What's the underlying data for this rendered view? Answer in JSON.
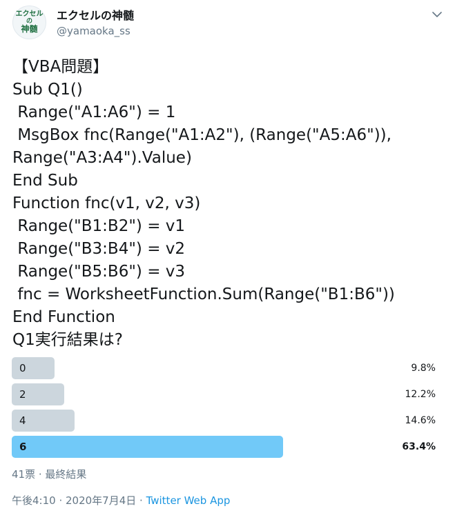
{
  "author": {
    "avatar_line1": "エクセル",
    "avatar_line2": "の",
    "avatar_line3": "神髄",
    "display_name": "エクセルの神髄",
    "handle": "@yamaoka_ss"
  },
  "icons": {
    "menu": "chevron-down-icon"
  },
  "tweet_text": "【VBA問題】\nSub Q1()\n Range(\"A1:A6\") = 1\n MsgBox fnc(Range(\"A1:A2\"), (Range(\"A5:A6\")),\nRange(\"A3:A4\").Value)\nEnd Sub\nFunction fnc(v1, v2, v3)\n Range(\"B1:B2\") = v1\n Range(\"B3:B4\") = v2\n Range(\"B5:B6\") = v3\n fnc = WorksheetFunction.Sum(Range(\"B1:B6\"))\nEnd Function\nQ1実行結果は?",
  "poll": {
    "options": [
      {
        "label": "0",
        "percent": "9.8%",
        "value": 9.8,
        "winner": false
      },
      {
        "label": "2",
        "percent": "12.2%",
        "value": 12.2,
        "winner": false
      },
      {
        "label": "4",
        "percent": "14.6%",
        "value": 14.6,
        "winner": false
      },
      {
        "label": "6",
        "percent": "63.4%",
        "value": 63.4,
        "winner": true
      }
    ],
    "meta": "41票 · 最終結果"
  },
  "footer": {
    "time_date": "午後4:10 · 2020年7月4日 · ",
    "app": "Twitter Web App"
  },
  "colors": {
    "bar": "#ccd6dd",
    "winner_bar": "#71c9f8",
    "link": "#1b95e0",
    "secondary_text": "#657786"
  }
}
